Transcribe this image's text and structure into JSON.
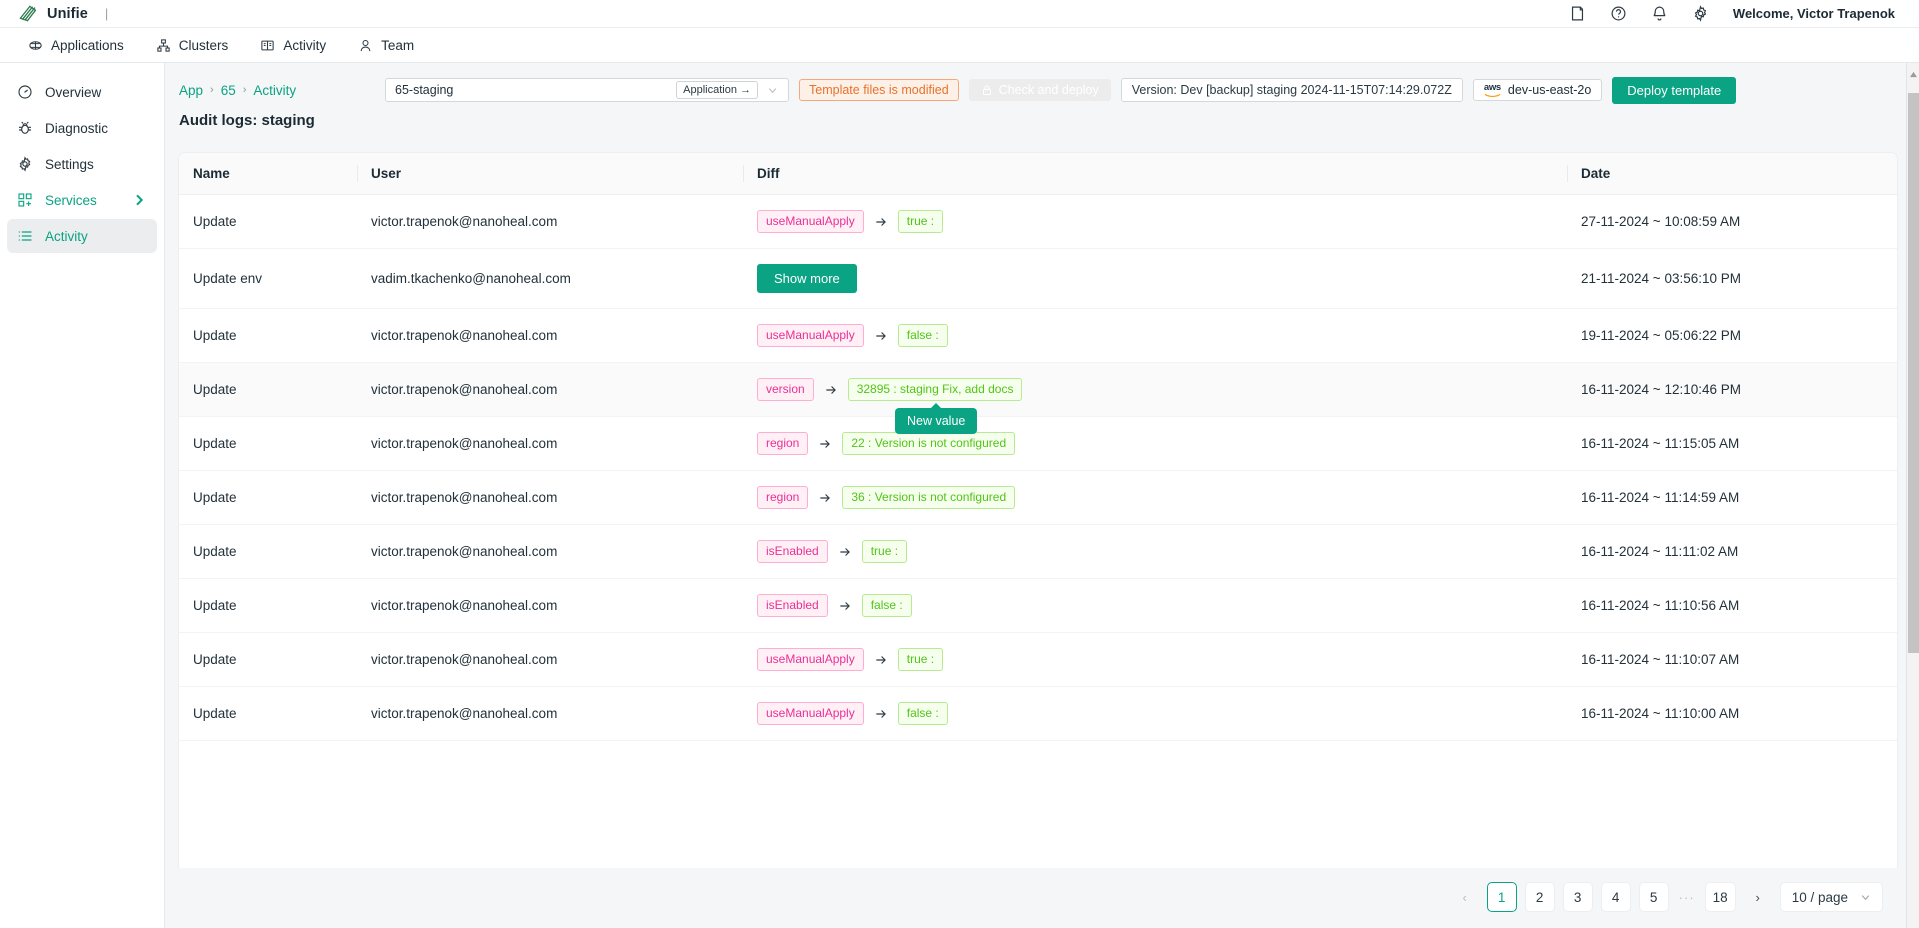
{
  "brand": {
    "name": "Unifie",
    "separator": "|",
    "welcome": "Welcome, Victor Trapenok"
  },
  "topnav": [
    {
      "label": "Applications",
      "icon": "applications-icon"
    },
    {
      "label": "Clusters",
      "icon": "clusters-icon"
    },
    {
      "label": "Activity",
      "icon": "activity-book-icon"
    },
    {
      "label": "Team",
      "icon": "team-user-icon"
    }
  ],
  "header_icons": [
    {
      "name": "docs-icon"
    },
    {
      "name": "help-circle-icon"
    },
    {
      "name": "bell-icon"
    },
    {
      "name": "gear-icon"
    }
  ],
  "sidebar": {
    "items": [
      {
        "label": "Overview",
        "icon": "gauge-icon",
        "teal": false,
        "active": false,
        "chevron": false
      },
      {
        "label": "Diagnostic",
        "icon": "bug-icon",
        "teal": false,
        "active": false,
        "chevron": false
      },
      {
        "label": "Settings",
        "icon": "gear-icon",
        "teal": false,
        "active": false,
        "chevron": false
      },
      {
        "label": "Services",
        "icon": "blocks-icon",
        "teal": true,
        "active": false,
        "chevron": true
      },
      {
        "label": "Activity",
        "icon": "list-icon",
        "teal": true,
        "active": true,
        "chevron": false
      }
    ]
  },
  "breadcrumb": {
    "items": [
      "App",
      "65",
      "Activity"
    ],
    "separator": "›"
  },
  "toolbar": {
    "app_input_value": "65-staging",
    "app_input_placeholder": "65-staging",
    "application_button": "Application →",
    "template_badge": "Template files is modified",
    "check_deploy_button": "Check and deploy",
    "version_box": "Version: Dev [backup] staging 2024-11-15T07:14:29.072Z",
    "aws_label": "aws",
    "region_label": "dev-us-east-2o",
    "deploy_button": "Deploy template"
  },
  "page": {
    "title": "Audit logs: staging"
  },
  "table": {
    "columns": [
      "Name",
      "User",
      "Diff",
      "Date"
    ],
    "rows": [
      {
        "name": "Update",
        "user": "victor.trapenok@nanoheal.com",
        "diff": {
          "kind": "pair",
          "key": "useManualApply",
          "value": "true :"
        },
        "date": "27-11-2024 ~ 10:08:59 AM"
      },
      {
        "name": "Update env",
        "user": "vadim.tkachenko@nanoheal.com",
        "diff": {
          "kind": "button",
          "label": "Show more"
        },
        "date": "21-11-2024 ~ 03:56:10 PM"
      },
      {
        "name": "Update",
        "user": "victor.trapenok@nanoheal.com",
        "diff": {
          "kind": "pair",
          "key": "useManualApply",
          "value": "false :"
        },
        "date": "19-11-2024 ~ 05:06:22 PM"
      },
      {
        "name": "Update",
        "user": "victor.trapenok@nanoheal.com",
        "diff": {
          "kind": "pair",
          "key": "version",
          "value": "32895 : staging Fix, add docs"
        },
        "date": "16-11-2024 ~ 12:10:46 PM"
      },
      {
        "name": "Update",
        "user": "victor.trapenok@nanoheal.com",
        "diff": {
          "kind": "pair",
          "key": "region",
          "value": "22 : Version is not configured"
        },
        "date": "16-11-2024 ~ 11:15:05 AM"
      },
      {
        "name": "Update",
        "user": "victor.trapenok@nanoheal.com",
        "diff": {
          "kind": "pair",
          "key": "region",
          "value": "36 : Version is not configured"
        },
        "date": "16-11-2024 ~ 11:14:59 AM"
      },
      {
        "name": "Update",
        "user": "victor.trapenok@nanoheal.com",
        "diff": {
          "kind": "pair",
          "key": "isEnabled",
          "value": "true :"
        },
        "date": "16-11-2024 ~ 11:11:02 AM"
      },
      {
        "name": "Update",
        "user": "victor.trapenok@nanoheal.com",
        "diff": {
          "kind": "pair",
          "key": "isEnabled",
          "value": "false :"
        },
        "date": "16-11-2024 ~ 11:10:56 AM"
      },
      {
        "name": "Update",
        "user": "victor.trapenok@nanoheal.com",
        "diff": {
          "kind": "pair",
          "key": "useManualApply",
          "value": "true :"
        },
        "date": "16-11-2024 ~ 11:10:07 AM"
      },
      {
        "name": "Update",
        "user": "victor.trapenok@nanoheal.com",
        "diff": {
          "kind": "pair",
          "key": "useManualApply",
          "value": "false :"
        },
        "date": "16-11-2024 ~ 11:10:00 AM"
      }
    ]
  },
  "tooltip": {
    "text": "New value"
  },
  "pagination": {
    "prev": "‹",
    "next": "›",
    "pages": [
      "1",
      "2",
      "3",
      "4",
      "5"
    ],
    "ellipsis": "···",
    "last": "18",
    "current": "1",
    "page_size": "10 / page"
  },
  "colors": {
    "accent": "#0aa384",
    "warn": "#e8722b",
    "tag_key": "#eb2f96",
    "tag_value": "#52c41a"
  }
}
